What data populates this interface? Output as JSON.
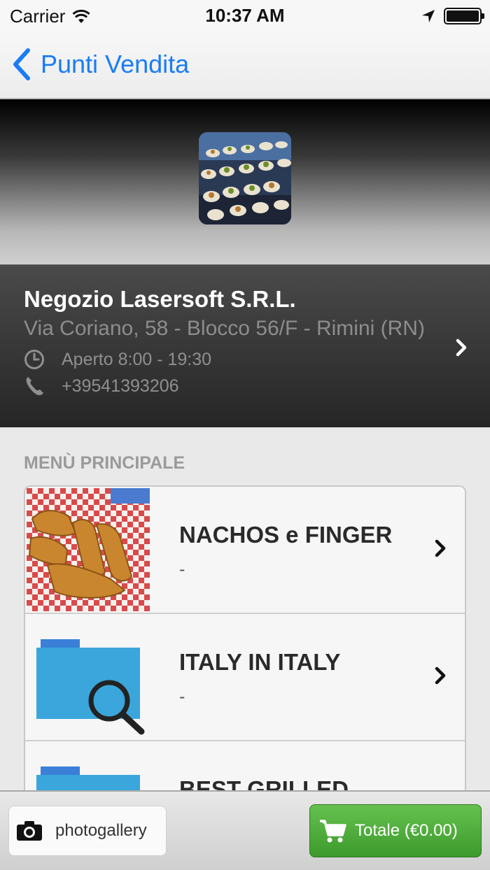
{
  "status_bar": {
    "carrier": "Carrier",
    "time": "10:37 AM"
  },
  "nav": {
    "back_label": "Punti Vendita"
  },
  "store": {
    "name": "Negozio Lasersoft S.R.L.",
    "address": "Via Coriano, 58 - Blocco 56/F - Rimini (RN)",
    "hours": "Aperto 8:00 - 19:30",
    "phone": "+39541393206"
  },
  "menu": {
    "section_title": "MENÙ PRINCIPALE",
    "items": [
      {
        "title": "NACHOS e FINGER",
        "subtitle": "-"
      },
      {
        "title": "ITALY IN ITALY",
        "subtitle": "-"
      },
      {
        "title": "BEST GRILLED",
        "subtitle": "-"
      }
    ]
  },
  "toolbar": {
    "photogallery_label": "photogallery",
    "total_label": "Totale (€0.00)"
  },
  "colors": {
    "accent_blue": "#1a7cf6",
    "cart_green": "#4fae3a",
    "folder_blue": "#3aa6dc"
  },
  "icons": [
    "wifi-icon",
    "location-arrow-icon",
    "battery-icon",
    "back-chevron-icon",
    "clock-icon",
    "phone-icon",
    "chevron-right-icon",
    "folder-search-icon",
    "camera-icon",
    "cart-icon"
  ]
}
